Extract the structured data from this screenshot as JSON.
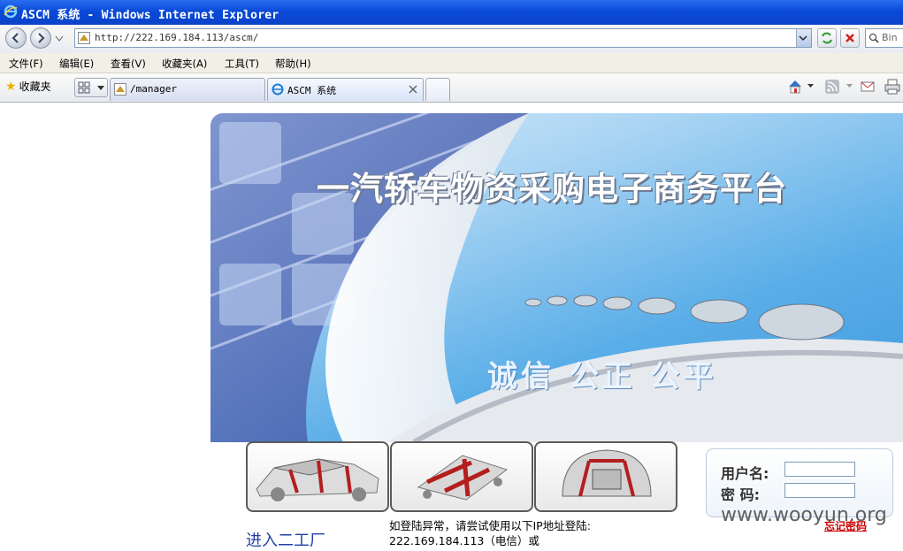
{
  "window": {
    "title": "ASCM 系统 - Windows Internet Explorer"
  },
  "address": {
    "url": "http://222.169.184.113/ascm/"
  },
  "search": {
    "placeholder": "Bin"
  },
  "menu": [
    "文件(F)",
    "编辑(E)",
    "查看(V)",
    "收藏夹(A)",
    "工具(T)",
    "帮助(H)"
  ],
  "favorites": {
    "label": "收藏夹"
  },
  "tabs": [
    {
      "label": "/manager",
      "active": false
    },
    {
      "label": "ASCM 系统",
      "active": true
    }
  ],
  "banner": {
    "title": "一汽轿车物资采购电子商务平台",
    "slogan": "诚信 公正 公平"
  },
  "login": {
    "username_label": "用户名:",
    "password_label": "密 码:"
  },
  "links": {
    "enter": "进入二工厂",
    "forgot": "忘记密码"
  },
  "notice": {
    "line1": "如登陆异常，请尝试使用以下IP地址登陆:",
    "line2": "222.169.184.113（电信）或"
  },
  "watermark": "www.wooyun.org",
  "colors": {
    "titlebar": "#0a4ad8",
    "banner_blue": "#3e98dc",
    "banner_title": "#ffffff",
    "slogan": "#e8f4ff"
  }
}
